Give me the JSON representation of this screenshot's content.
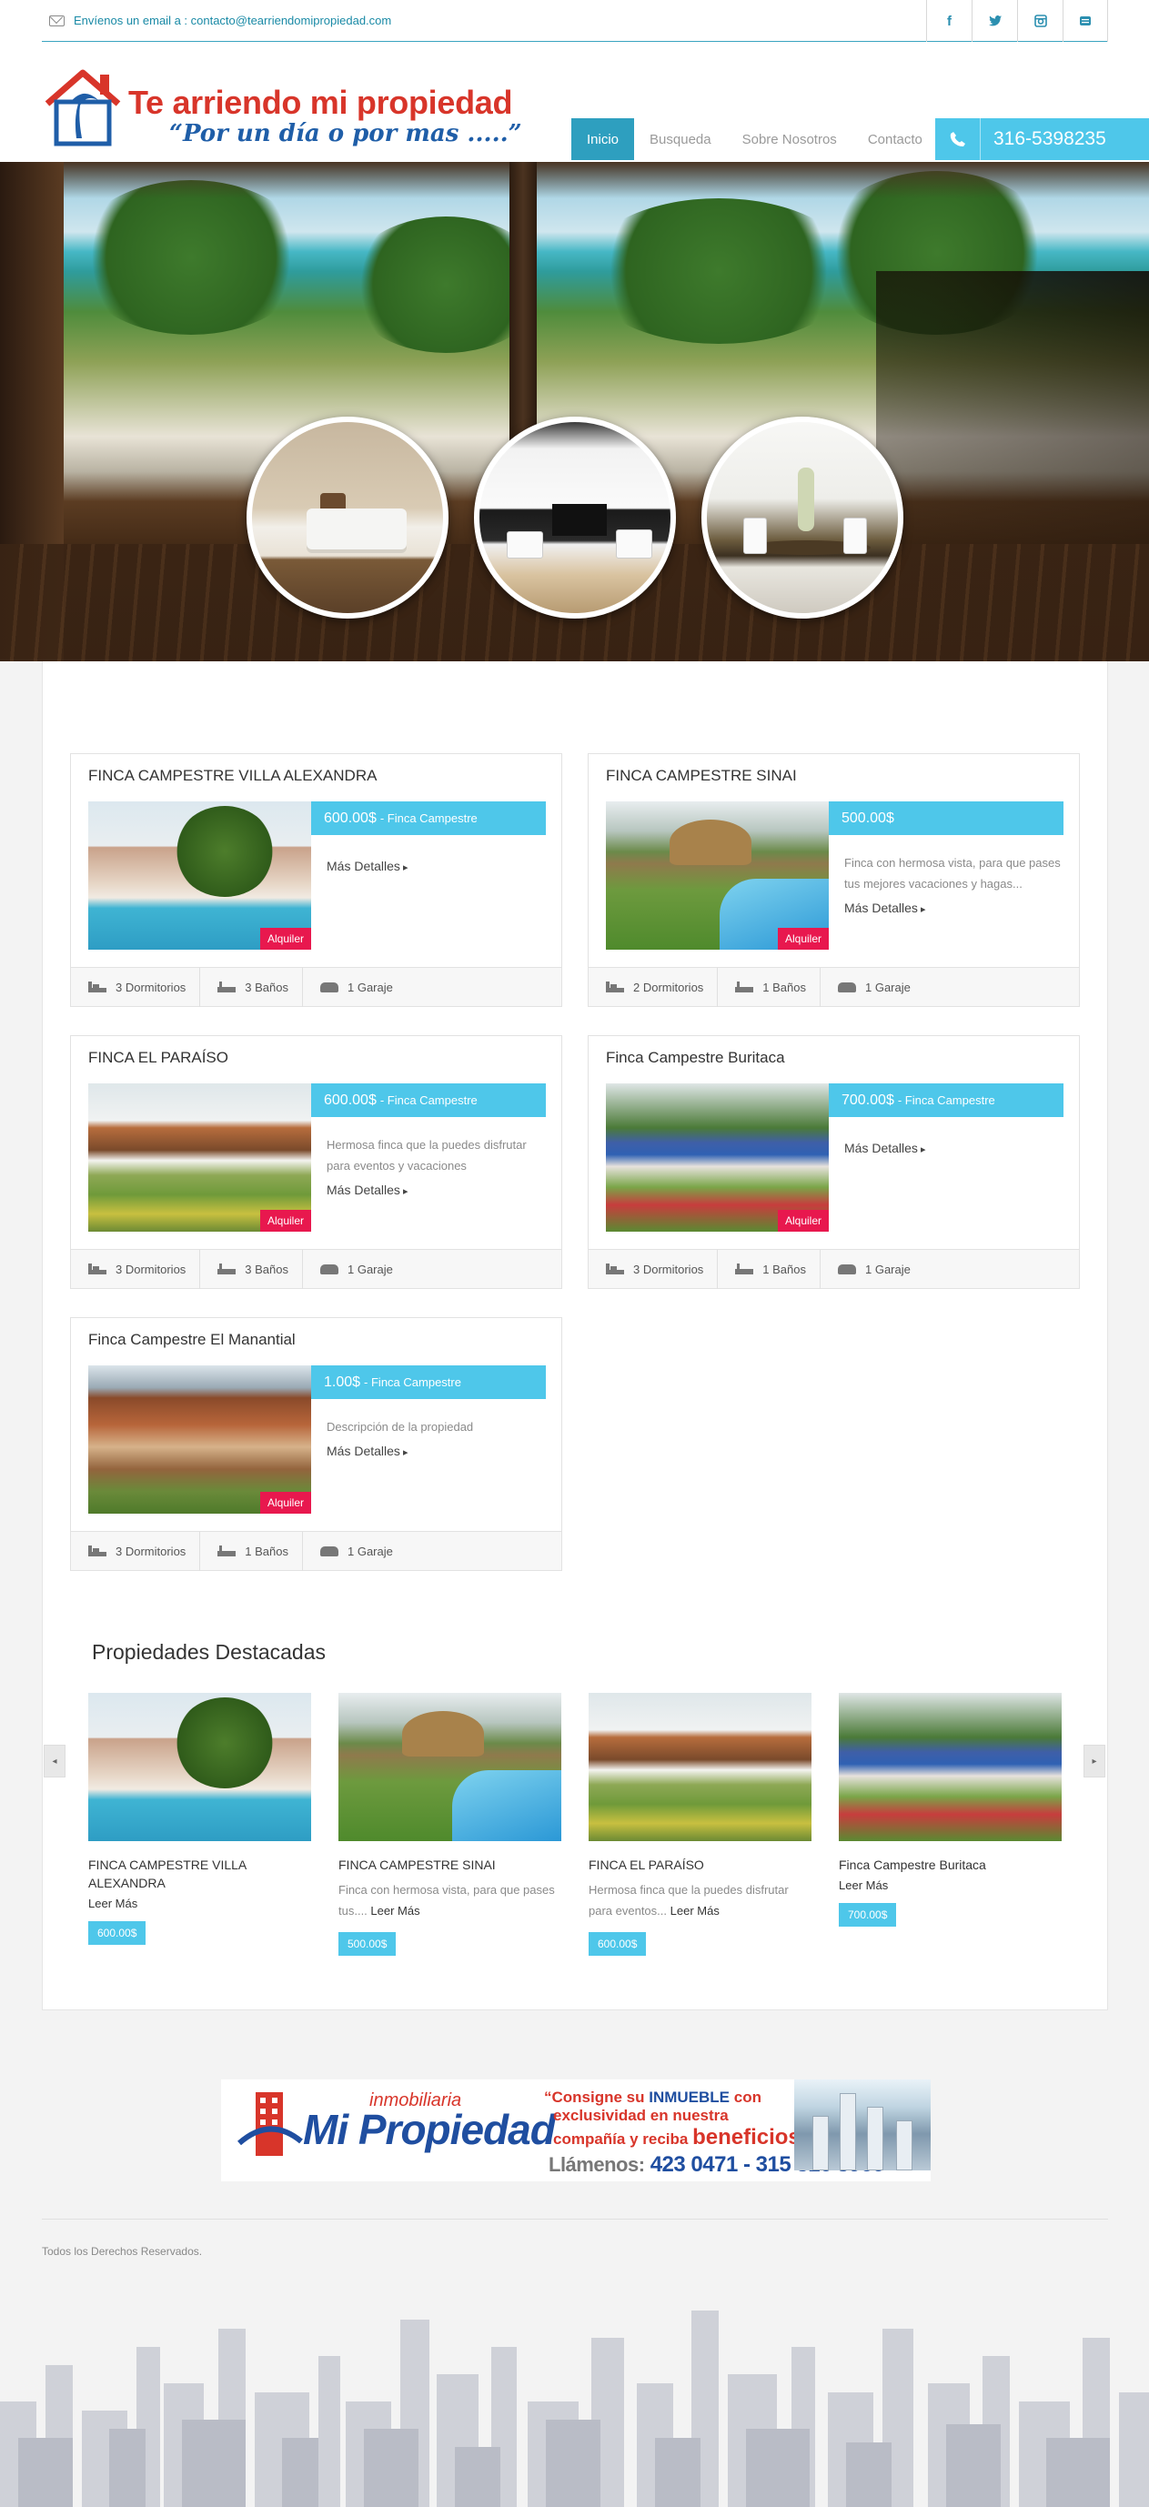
{
  "topbar": {
    "email_text": "Envíenos un email a : contacto@tearriendomipropiedad.com",
    "socials": [
      "f",
      "t",
      "ig",
      "yt"
    ]
  },
  "brand": {
    "title": "Te arriendo mi propiedad",
    "slogan": "“Por un día o por mas .....”"
  },
  "nav": {
    "items": [
      "Inicio",
      "Busqueda",
      "Sobre Nosotros",
      "Contacto"
    ],
    "active": "Inicio",
    "phone": "316-5398235"
  },
  "properties": [
    {
      "title": "FINCA CAMPESTRE VILLA ALEXANDRA",
      "price": "600.00$",
      "type": "- Finca Campestre",
      "desc": "",
      "more": "Más Detalles",
      "badge": "Alquiler",
      "beds": "3 Dormitorios",
      "baths": "3 Baños",
      "garage": "1 Garaje"
    },
    {
      "title": "FINCA CAMPESTRE SINAI",
      "price": "500.00$",
      "type": "",
      "desc": "Finca con hermosa vista, para que pases tus mejores vacaciones y hagas...",
      "more": "Más Detalles",
      "badge": "Alquiler",
      "beds": "2 Dormitorios",
      "baths": "1 Baños",
      "garage": "1 Garaje"
    },
    {
      "title": "FINCA EL PARAÍSO",
      "price": "600.00$",
      "type": "- Finca Campestre",
      "desc": "Hermosa finca  que la puedes disfrutar para eventos y vacaciones",
      "more": "Más Detalles",
      "badge": "Alquiler",
      "beds": "3 Dormitorios",
      "baths": "3 Baños",
      "garage": "1 Garaje"
    },
    {
      "title": "Finca Campestre Buritaca",
      "price": "700.00$",
      "type": "- Finca Campestre",
      "desc": "",
      "more": "Más Detalles",
      "badge": "Alquiler",
      "beds": "3 Dormitorios",
      "baths": "1 Baños",
      "garage": "1 Garaje"
    },
    {
      "title": "Finca Campestre El Manantial",
      "price": "1.00$",
      "type": "- Finca Campestre",
      "desc": "Descripción de la propiedad",
      "more": "Más Detalles",
      "badge": "Alquiler",
      "beds": "3 Dormitorios",
      "baths": "1 Baños",
      "garage": "1 Garaje"
    }
  ],
  "featured": {
    "title": "Propiedades Destacadas",
    "prev": "◂",
    "next": "▸",
    "items": [
      {
        "name": "FINCA CAMPESTRE VILLA ALEXANDRA",
        "desc": "",
        "more": "Leer Más",
        "price": "600.00$"
      },
      {
        "name": "FINCA CAMPESTRE SINAI",
        "desc": "Finca con hermosa vista, para que pases tus....",
        "more": "Leer Más",
        "price": "500.00$"
      },
      {
        "name": "FINCA EL PARAÍSO",
        "desc": "Hermosa finca  que la puedes disfrutar para eventos...",
        "more": "Leer Más",
        "price": "600.00$"
      },
      {
        "name": "Finca Campestre Buritaca",
        "desc": "",
        "more": "Leer Más",
        "price": "700.00$"
      }
    ]
  },
  "banner": {
    "inmo": "inmobiliaria",
    "brand": "Mi Propiedad",
    "line1_a": "“Consigne su ",
    "line1_b": "INMUEBLE",
    "line1_c": " con",
    "line2": "exclusividad en nuestra",
    "line3_a": "compañía y reciba ",
    "line3_b": "beneficios",
    "call_label": "Llámenos:",
    "call_numbers": "423 0471  - 315 816 8966"
  },
  "footer": {
    "copyright": "Todos los Derechos Reservados."
  }
}
